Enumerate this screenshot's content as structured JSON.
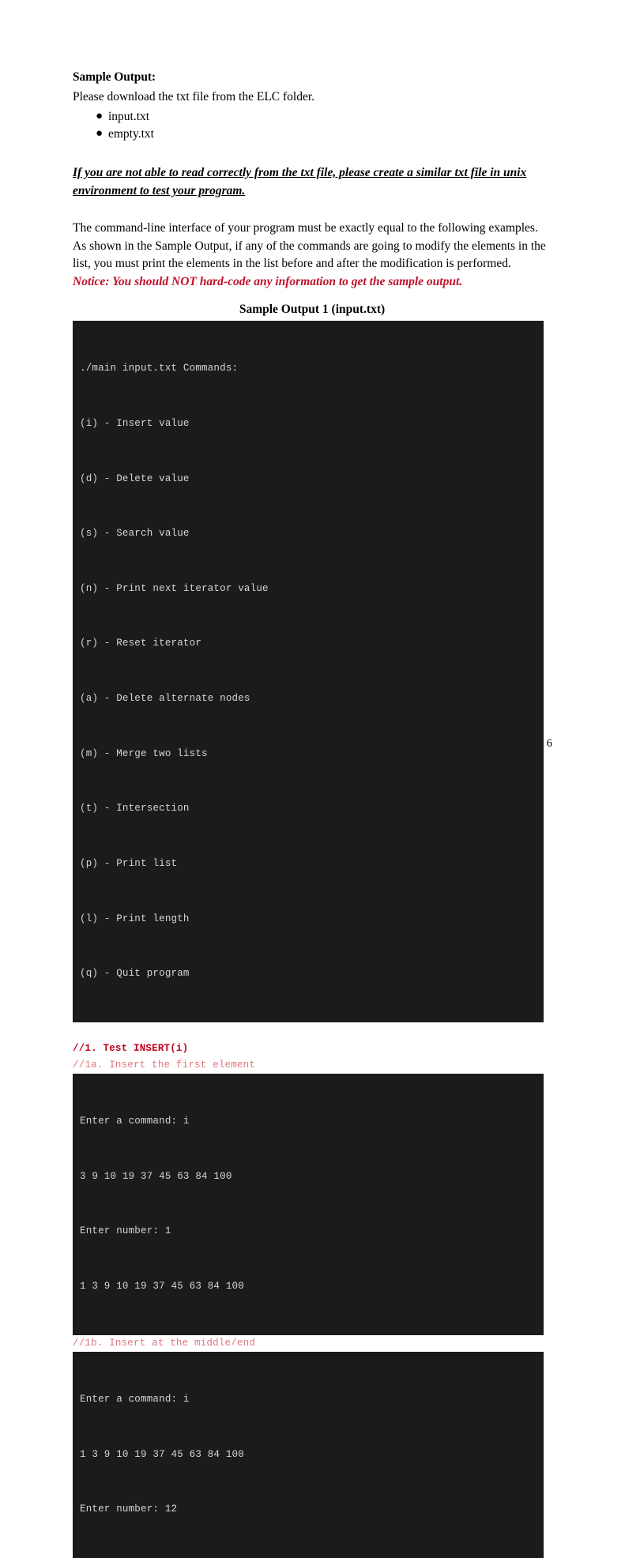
{
  "document": {
    "page_number": "6",
    "heading_sample_output": "Sample Output:",
    "download_instruction": "Please download the txt file from the ELC folder.",
    "files": [
      {
        "bullet": "●",
        "name": "input.txt"
      },
      {
        "bullet": "●",
        "name": "empty.txt"
      }
    ],
    "notice_underlined": "If you are not able to read correctly from the txt file, please create a similar txt file in unix environment to test your program.",
    "paragraph_lines": [
      "The command-line interface of your program must be exactly equal to the following examples.",
      "As shown in the Sample Output, if any of the commands are going to modify the elements in the",
      "list, you must print the elements in the list before and after the modification is performed."
    ],
    "notice_red": "Notice: You should NOT hard-code any information to get the sample output.",
    "sample_output_title": "Sample Output 1 (input.txt)"
  },
  "terminal_menu": {
    "lines": [
      "./main input.txt Commands:",
      "(i) - Insert value",
      "(d) - Delete value",
      "(s) - Search value",
      "(n) - Print next iterator value",
      "(r) - Reset iterator",
      "(a) - Delete alternate nodes",
      "(m) - Merge two lists",
      "(t) - Intersection",
      "(p) - Print list",
      "(l) - Print length",
      "(q) - Quit program"
    ]
  },
  "test_sections": [
    {
      "comment_strong": "//1. Test INSERT(i)",
      "comment_light": "//1a. Insert the first element",
      "terminal_lines": [
        "Enter a command: i",
        "3 9 10 19 37 45 63 84 100",
        "Enter number: 1",
        "1 3 9 10 19 37 45 63 84 100"
      ]
    },
    {
      "comment_light": "//1b. Insert at the middle/end",
      "terminal_lines": [
        "Enter a command: i",
        "1 3 9 10 19 37 45 63 84 100",
        "Enter number: 12"
      ]
    }
  ],
  "colors": {
    "terminal_bg": "#1b1b1b",
    "terminal_fg": "#d6d6d6",
    "notice_red": "#c0112a",
    "comment_strong_red": "#c00020",
    "comment_light_red": "#e3737f"
  }
}
